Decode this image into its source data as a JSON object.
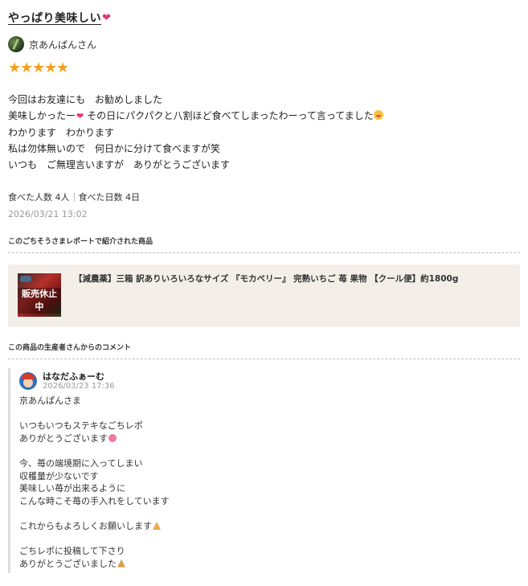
{
  "review": {
    "title": "やっぱり美味しい",
    "title_icon": "heart-icon",
    "user": "京あんぱんさん",
    "rating": 5,
    "lines": [
      "今回はお友達にも　お勧めしました",
      "美味しかったー",
      "その日にパクパクと八割ほど食べてしまったわーって言ってました",
      "わかります　わかります",
      "私は勿体無いので　何日かに分けて食べますが笑",
      "いつも　ご無理言いますが　ありがとうございます"
    ],
    "stats": {
      "people": "食べた人数 4人",
      "days": "食べた日数 4日"
    },
    "date": "2026/03/21 13:02"
  },
  "product_section": {
    "label": "このごちそうさまレポートで紹介された商品",
    "product_name": "【減農薬】三箱 訳ありいろいろなサイズ 『モカベリー』 完熟いちご 苺 果物 【クール便】約1800g",
    "status_badge": "販売休止中"
  },
  "comment_section": {
    "label": "この商品の生産者さんからのコメント",
    "author": "はなだふぁーむ",
    "date": "2026/03/23 17:36",
    "lines": [
      "京あんぱんさま",
      "",
      "いつもいつもステキなごちレポ",
      "ありがとうございます",
      "",
      "今、苺の端境期に入ってしまい",
      "収穫量が少ないです",
      "美味しい苺が出来るように",
      "こんな時こそ苺の手入れをしています",
      "",
      "これからもよろしくお願いします",
      "",
      "ごちレポに投稿して下さり",
      "ありがとうございました"
    ]
  },
  "colors": {
    "star": "#f2a122",
    "heart": "#e8336d",
    "product_bg": "#f3efe8"
  }
}
